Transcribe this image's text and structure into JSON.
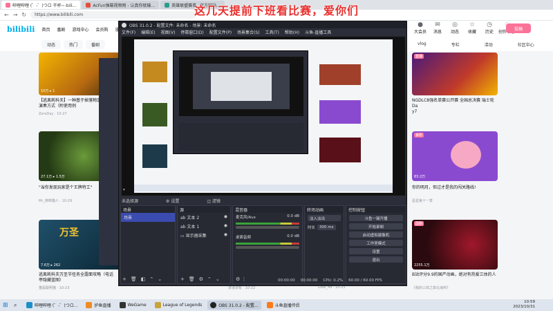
{
  "overlay_title": "这几天提前下班看比赛，爱你们",
  "browser": {
    "tabs": [
      "哔哩哔哩 (゜-゜)つロ 干杯~-bili...",
      "AcFun弹幕视频网 - 认真你就输...",
      "英雄联盟赛事_ 官方网站..."
    ],
    "url": "https://www.bilibili.com"
  },
  "bili": {
    "logo": "bilibili",
    "nav": [
      "首页",
      "番剧",
      "游戏中心",
      "会员购",
      "漫画",
      "赛事"
    ],
    "user_icons": [
      "大会员",
      "消息",
      "动态",
      "收藏",
      "历史",
      "创作中心"
    ],
    "upload": "投稿",
    "channels": [
      "动态",
      "热门",
      "番剧",
      "国创",
      "综艺",
      "专栏",
      "直播"
    ],
    "channels_right": [
      "vlog",
      "专栏",
      "活动",
      "社区中心"
    ]
  },
  "cards_left": [
    {
      "title": "【逃离耗科夫】一种基于掉落物定位",
      "subtitle": "演奏方式（附使用例",
      "meta": "ZeroDay · 10-27",
      "views": "10万",
      "likes": "1"
    },
    {
      "title": "\"当你发现玩家是个王牌特工\"",
      "subtitle": "",
      "meta": "Mr_棉棉猫人 · 10-29",
      "views": "27.1万",
      "likes": "1.5万"
    },
    {
      "title": "逃离耗科夫万圣节任务全露面攻略（电话",
      "subtitle": "亭隐藏蓝图）",
      "meta": "艾比小霸王 · 10-30",
      "views": "7.6万",
      "likes": "262"
    }
  ],
  "cards_right": [
    {
      "title": "NGDLC8强名单赛公开赛 全国总决赛 瑞士轮 Da",
      "subtitle": "y7",
      "meta": "",
      "views": "",
      "likes": "",
      "badge": "直播"
    },
    {
      "title": "你的明月，但过才是我的闯关路线!",
      "subtitle": "",
      "meta": "星星第十一季",
      "views": "83.2万",
      "likes": "",
      "badge": "番剧"
    },
    {
      "title": "B站评分9.9的国产动画，绝对有热爱三体的人",
      "subtitle": "",
      "meta": "《我的三体之章北海传》",
      "views": "2255.1万",
      "likes": "",
      "badge": "国剧"
    }
  ],
  "bottom_meta": [
    "猫是聪明猫 · 10-23",
    "讲道讲有 · 10-22",
    "Gdal_4d · 10-25"
  ],
  "obs": {
    "title": "OBS 31.0.2 - 配置文件: 未命名 - 场景: 未命名",
    "menu": [
      "文件(F)",
      "编辑(E)",
      "视图(V)",
      "停靠窗口(D)",
      "配置文件(P)",
      "场景集合(S)",
      "工具(T)",
      "帮助(H)",
      "斗鱼-直播工具"
    ],
    "no_source": "未选择源",
    "props_btn": "设置",
    "filter_btn": "滤镜",
    "docks": {
      "scenes": {
        "title": "场景",
        "items": [
          "场景"
        ]
      },
      "sources": {
        "title": "源",
        "items": [
          "文本 2",
          "文本 1",
          "显示器采集"
        ]
      },
      "mixer": {
        "title": "混音器",
        "tracks": [
          {
            "name": "桌面音频",
            "db": "0.0 dB"
          },
          {
            "name": "麦克风/Aux",
            "db": "0.0 dB"
          }
        ]
      },
      "transitions": {
        "title": "转场动画",
        "type": "淡入淡出",
        "duration_label": "时长",
        "duration": "300 ms"
      },
      "controls": {
        "title": "控制按钮",
        "buttons": [
          "斗鱼一键开播",
          "开始录制",
          "启动虚拟摄像机",
          "工作室模式",
          "设置",
          "退出"
        ]
      }
    },
    "status": {
      "time1": "00:00:00",
      "time2": "00:00:00",
      "cpu": "CPU: 0.2%",
      "fps": "60.00 / 60.00 FPS"
    }
  },
  "taskbar": {
    "items": [
      "哔哩哔哩 (゜-゜)つロ...",
      "护鱼直播",
      "WeGame",
      "League of Legends",
      "OBS 31.0.2 - 配置...",
      "斗鱼直播伴侣"
    ],
    "time": "10:59",
    "date": "2023/10/31"
  }
}
